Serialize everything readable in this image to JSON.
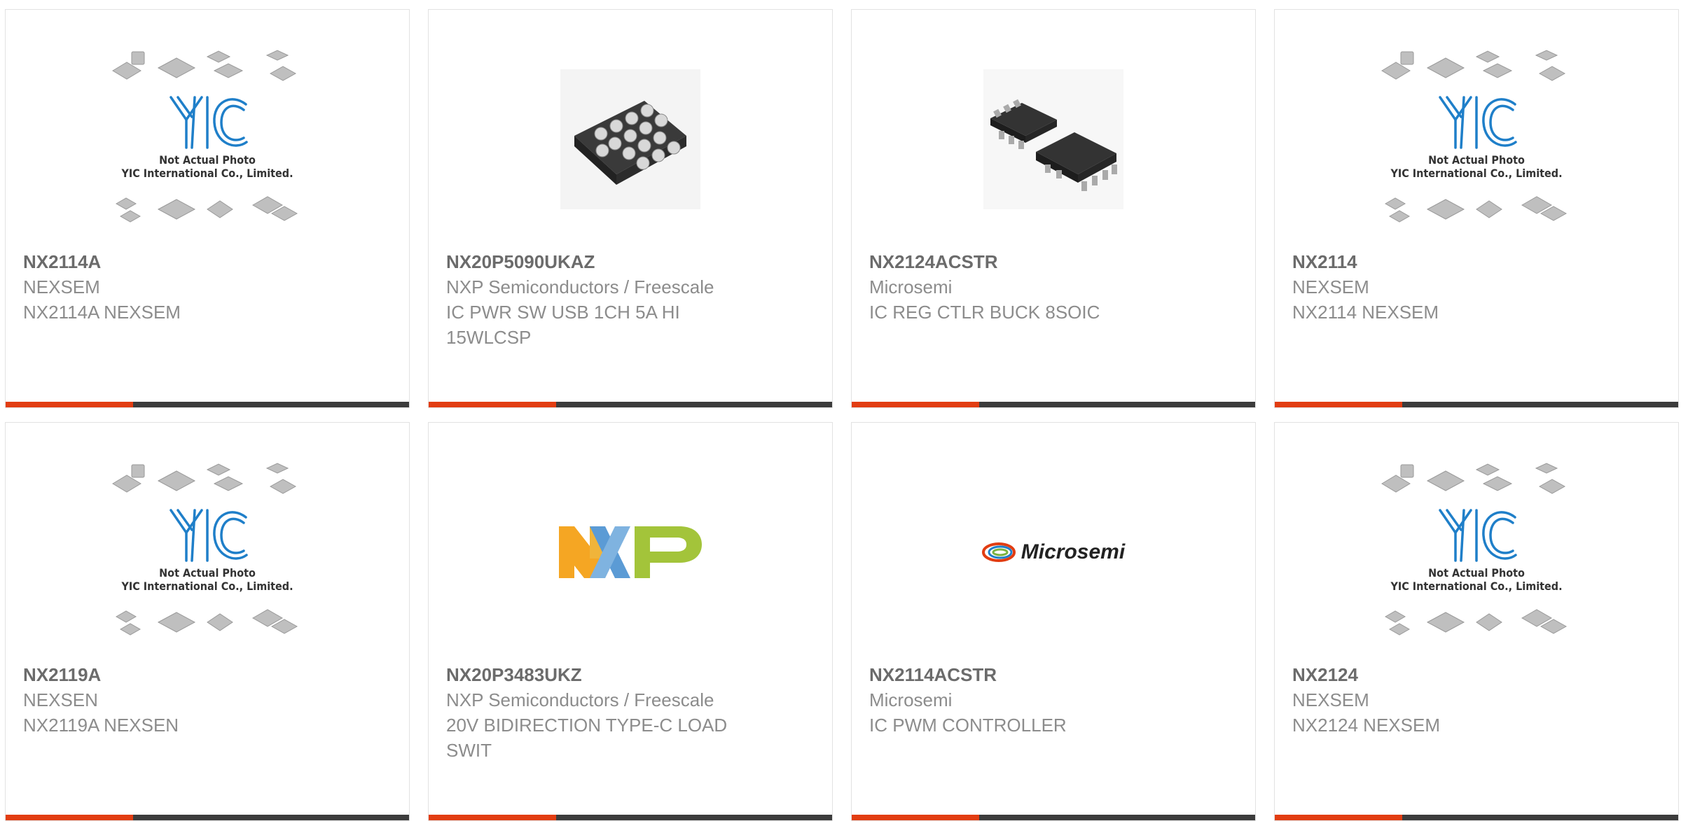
{
  "products": [
    {
      "part_number": "NX2114A",
      "manufacturer": "NEXSEM",
      "description": "NX2114A NEXSEM",
      "image": "yic-placeholder",
      "placeholder_text_1": "Not Actual Photo",
      "placeholder_text_2": "YIC International Co., Limited."
    },
    {
      "part_number": "NX20P5090UKAZ",
      "manufacturer": "NXP Semiconductors / Freescale",
      "description": "IC PWR SW USB 1CH 5A HI 15WLCSP",
      "image": "wlcsp-chip-photo"
    },
    {
      "part_number": "NX2124ACSTR",
      "manufacturer": "Microsemi",
      "description": "IC REG CTLR BUCK 8SOIC",
      "image": "soic8-chip-photo"
    },
    {
      "part_number": "NX2114",
      "manufacturer": "NEXSEM",
      "description": "NX2114 NEXSEM",
      "image": "yic-placeholder",
      "placeholder_text_1": "Not Actual Photo",
      "placeholder_text_2": "YIC International Co., Limited."
    },
    {
      "part_number": "NX2119A",
      "manufacturer": "NEXSEN",
      "description": "NX2119A NEXSEN",
      "image": "yic-placeholder",
      "placeholder_text_1": "Not Actual Photo",
      "placeholder_text_2": "YIC International Co., Limited."
    },
    {
      "part_number": "NX20P3483UKZ",
      "manufacturer": "NXP Semiconductors / Freescale",
      "description": "20V BIDIRECTION TYPE-C LOAD SWIT",
      "image": "nxp-logo"
    },
    {
      "part_number": "NX2114ACSTR",
      "manufacturer": "Microsemi",
      "description": "IC PWM CONTROLLER",
      "image": "microsemi-logo",
      "logo_text": "Microsemi"
    },
    {
      "part_number": "NX2124",
      "manufacturer": "NEXSEM",
      "description": "NX2124 NEXSEM",
      "image": "yic-placeholder",
      "placeholder_text_1": "Not Actual Photo",
      "placeholder_text_2": "YIC International Co., Limited."
    }
  ],
  "colors": {
    "accent": "#e23d12",
    "bar": "#3c3c3c",
    "yic_blue": "#1f7fc9"
  }
}
